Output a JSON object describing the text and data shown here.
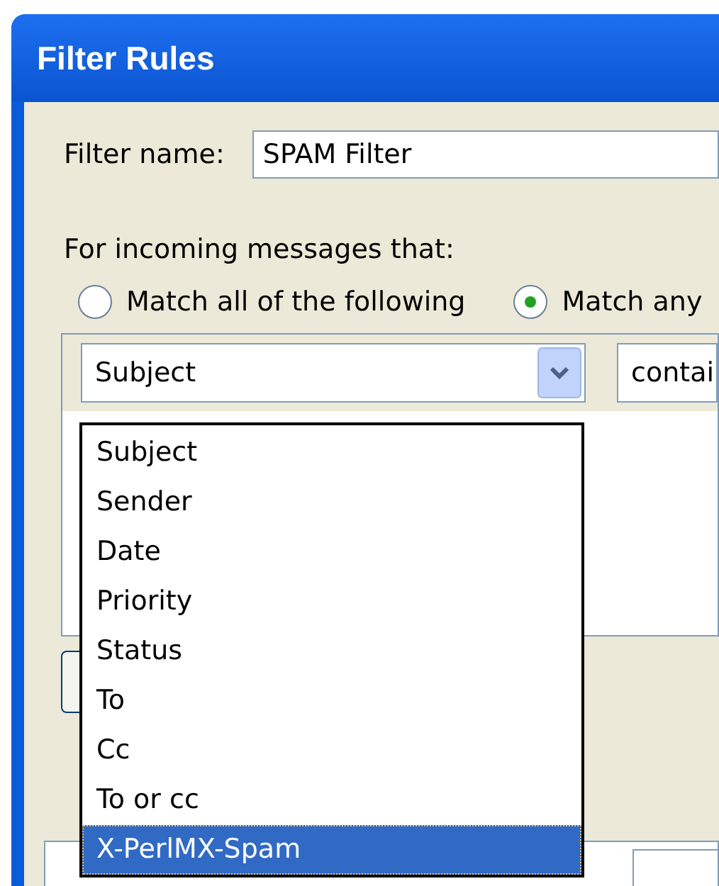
{
  "window": {
    "title": "Filter Rules"
  },
  "filter_name": {
    "label": "Filter name:",
    "value": "SPAM Filter"
  },
  "match": {
    "label": "For incoming messages that:",
    "options": [
      {
        "label": "Match all of the following",
        "selected": false
      },
      {
        "label": "Match any",
        "selected": true
      }
    ]
  },
  "rule": {
    "field": "Subject",
    "operator": "contai",
    "expanded": true,
    "options": [
      {
        "label": "Subject",
        "selected": false
      },
      {
        "label": "Sender",
        "selected": false
      },
      {
        "label": "Date",
        "selected": false
      },
      {
        "label": "Priority",
        "selected": false
      },
      {
        "label": "Status",
        "selected": false
      },
      {
        "label": "To",
        "selected": false
      },
      {
        "label": "Cc",
        "selected": false
      },
      {
        "label": "To or cc",
        "selected": false
      },
      {
        "label": "X-PerlMX-Spam",
        "selected": true
      }
    ]
  }
}
